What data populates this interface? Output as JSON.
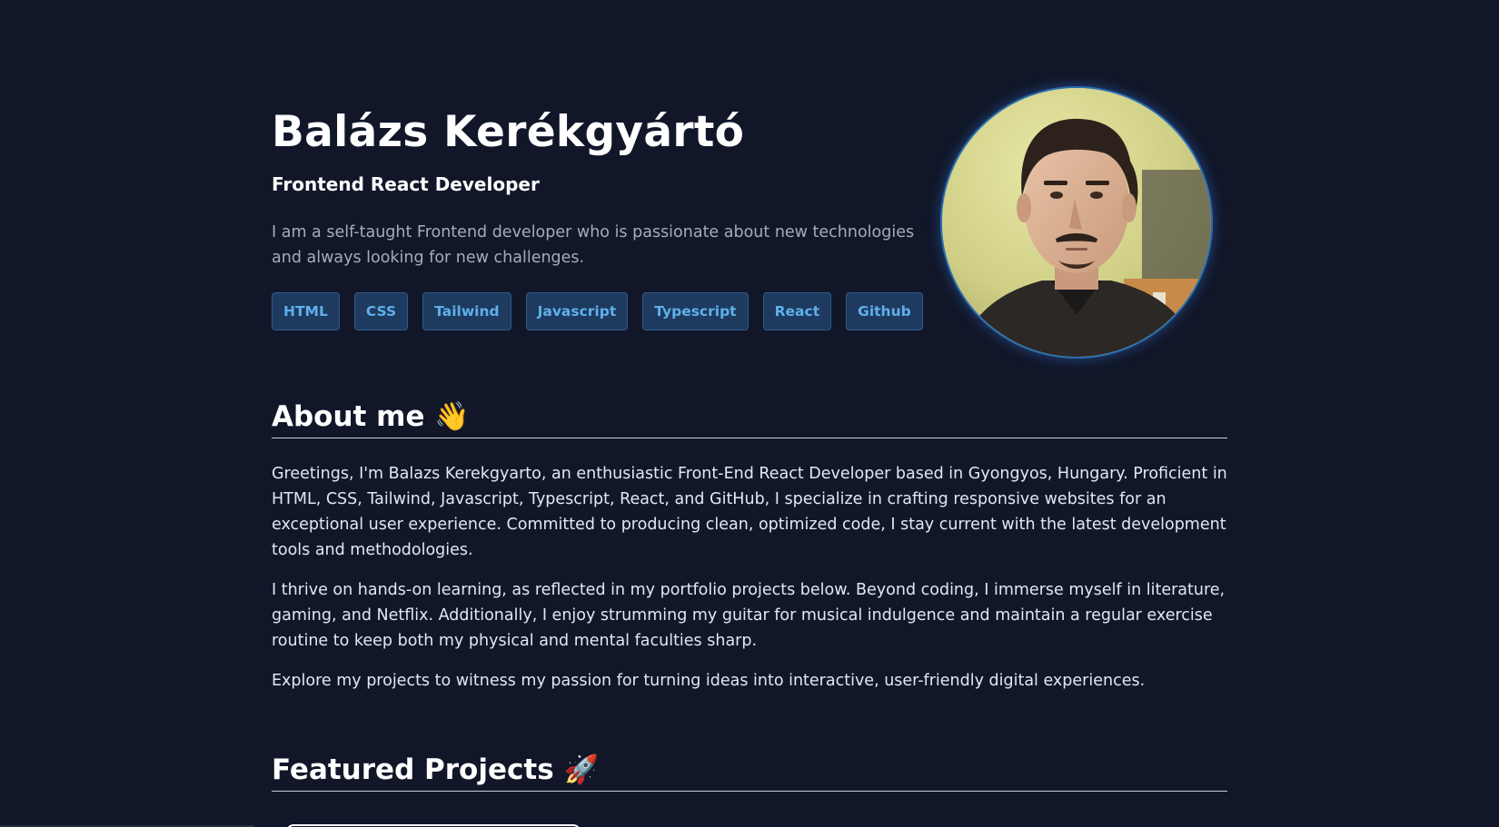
{
  "hero": {
    "name": "Balázs Kerékgyártó",
    "role": "Frontend React Developer",
    "intro": "I am a self-taught Frontend developer who is passionate about new technologies and always looking for new challenges.",
    "skills": [
      "HTML",
      "CSS",
      "Tailwind",
      "Javascript",
      "Typescript",
      "React",
      "Github"
    ]
  },
  "about": {
    "title": "About me 👋",
    "paragraphs": [
      "Greetings, I'm Balazs Kerekgyarto, an enthusiastic Front-End React Developer based in Gyongyos, Hungary. Proficient in HTML, CSS, Tailwind, Javascript, Typescript, React, and GitHub, I specialize in crafting responsive websites for an exceptional user experience. Committed to producing clean, optimized code, I stay current with the latest development tools and methodologies.",
      "I thrive on hands-on learning, as reflected in my portfolio projects below. Beyond coding, I immerse myself in literature, gaming, and Netflix. Additionally, I enjoy strumming my guitar for musical indulgence and maintain a regular exercise routine to keep both my physical and mental faculties sharp.",
      "Explore my projects to witness my passion for turning ideas into interactive, user-friendly digital experiences."
    ]
  },
  "projects": {
    "title": "Featured Projects 🚀"
  },
  "colors": {
    "background": "#111729",
    "skill_bg": "#1e3a5f",
    "skill_text": "#5fb0ea",
    "avatar_ring": "#2a6fb0"
  }
}
